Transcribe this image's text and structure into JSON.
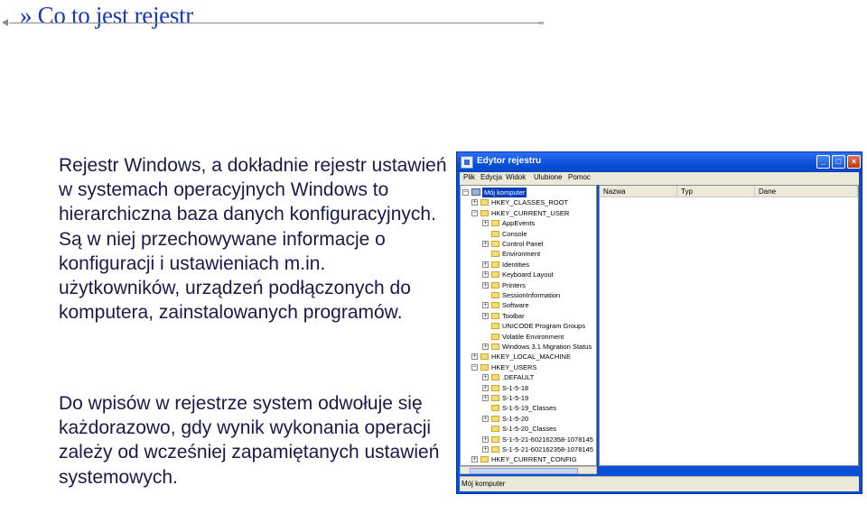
{
  "slide": {
    "title": "» Co to jest rejestr",
    "paragraph1": "Rejestr Windows, a dokładnie rejestr ustawień w systemach operacyjnych Windows to hierarchiczna baza danych konfiguracyjnych. Są w niej przechowywane informacje o konfiguracji i ustawieniach m.in. użytkowników, urządzeń podłączonych do komputera, zainstalowanych programów.",
    "paragraph2": "Do wpisów w rejestrze system odwołuje się każdorazowo, gdy wynik wykonania operacji zależy od wcześniej zapamiętanych ustawień systemowych."
  },
  "window": {
    "title": "Edytor rejestru",
    "menu": [
      "Plik",
      "Edycja",
      "Widok",
      "Ulubione",
      "Pomoc"
    ],
    "columns": [
      "Nazwa",
      "Typ",
      "Dane"
    ],
    "status": "Mój komputer",
    "tree": [
      {
        "label": "Mój komputer",
        "level": 0,
        "exp": "−",
        "selected": true,
        "icon": "computer-icon"
      },
      {
        "label": "HKEY_CLASSES_ROOT",
        "level": 1,
        "exp": "+"
      },
      {
        "label": "HKEY_CURRENT_USER",
        "level": 1,
        "exp": "−"
      },
      {
        "label": "AppEvents",
        "level": 2,
        "exp": "+"
      },
      {
        "label": "Console",
        "level": 2,
        "exp": ""
      },
      {
        "label": "Control Panel",
        "level": 2,
        "exp": "+"
      },
      {
        "label": "Environment",
        "level": 2,
        "exp": ""
      },
      {
        "label": "Identities",
        "level": 2,
        "exp": "+"
      },
      {
        "label": "Keyboard Layout",
        "level": 2,
        "exp": "+"
      },
      {
        "label": "Printers",
        "level": 2,
        "exp": "+"
      },
      {
        "label": "SessionInformation",
        "level": 2,
        "exp": ""
      },
      {
        "label": "Software",
        "level": 2,
        "exp": "+"
      },
      {
        "label": "Toolbar",
        "level": 2,
        "exp": "+"
      },
      {
        "label": "UNICODE Program Groups",
        "level": 2,
        "exp": ""
      },
      {
        "label": "Volatile Environment",
        "level": 2,
        "exp": ""
      },
      {
        "label": "Windows 3.1 Migration Status",
        "level": 2,
        "exp": "+"
      },
      {
        "label": "HKEY_LOCAL_MACHINE",
        "level": 1,
        "exp": "+"
      },
      {
        "label": "HKEY_USERS",
        "level": 1,
        "exp": "−"
      },
      {
        "label": ".DEFAULT",
        "level": 2,
        "exp": "+"
      },
      {
        "label": "S-1-5-18",
        "level": 2,
        "exp": "+"
      },
      {
        "label": "S-1-5-19",
        "level": 2,
        "exp": "+"
      },
      {
        "label": "S-1-5-19_Classes",
        "level": 2,
        "exp": ""
      },
      {
        "label": "S-1-5-20",
        "level": 2,
        "exp": "+"
      },
      {
        "label": "S-1-5-20_Classes",
        "level": 2,
        "exp": ""
      },
      {
        "label": "S-1-5-21-602162358-1078145",
        "level": 2,
        "exp": "+"
      },
      {
        "label": "S-1-5-21-602162358-1078145",
        "level": 2,
        "exp": "+"
      },
      {
        "label": "HKEY_CURRENT_CONFIG",
        "level": 1,
        "exp": "+"
      }
    ]
  }
}
